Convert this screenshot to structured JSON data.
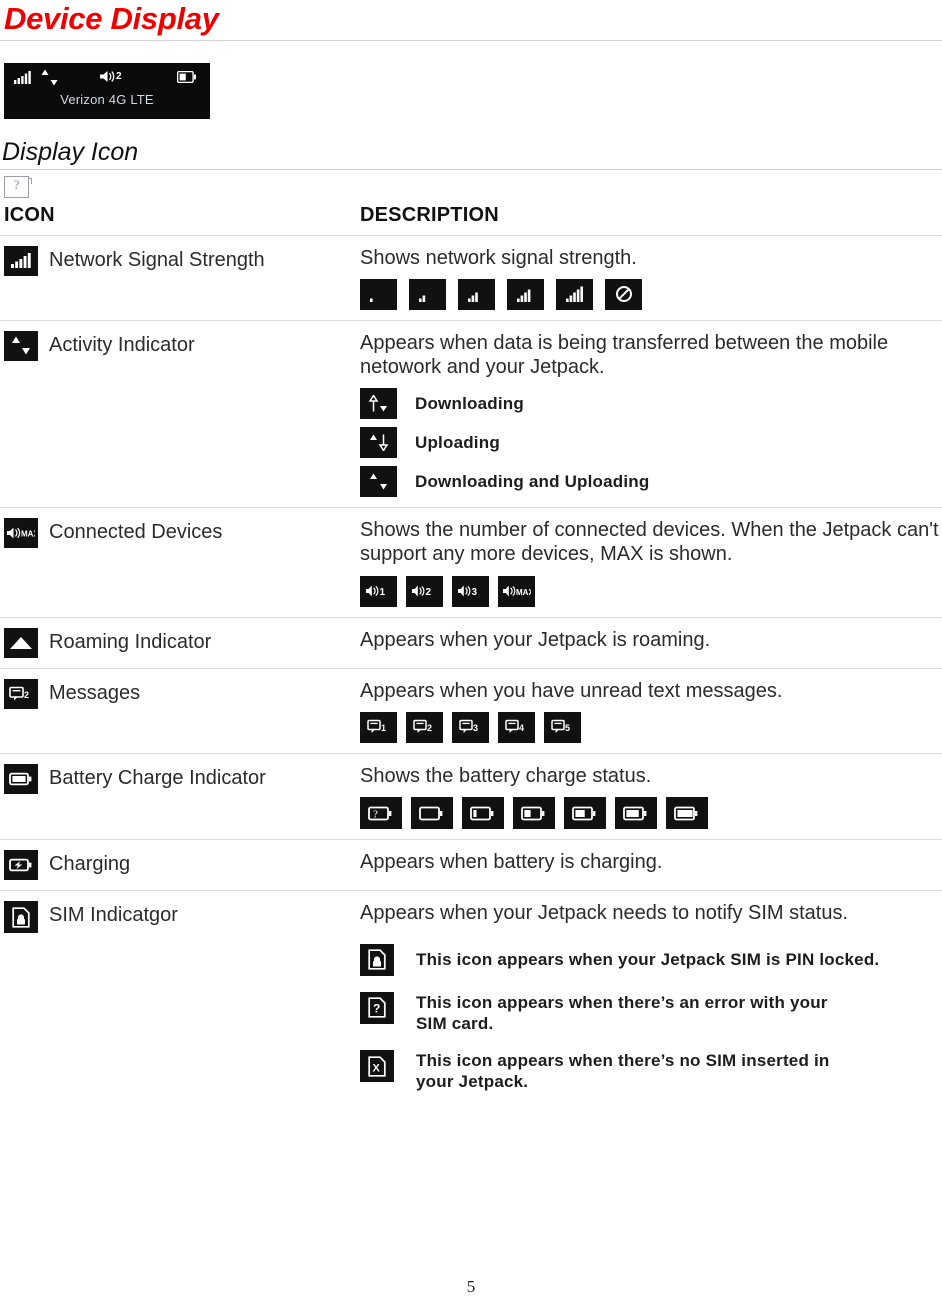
{
  "document": {
    "title": "Device Display",
    "subheading": "Display Icon",
    "page_number": "5",
    "broken_image_placeholder": "broken-image-icon"
  },
  "device_display": {
    "carrier_text": "Verizon 4G LTE",
    "connected_devices_count": "2",
    "icons": [
      "signal-bars-icon",
      "activity-updown-icon",
      "connected-devices-icon",
      "battery-icon"
    ]
  },
  "table": {
    "headers": {
      "icon": "ICON",
      "description": "DESCRIPTION"
    },
    "rows": [
      {
        "name": "Network Signal Strength",
        "icon": "signal-bars-icon",
        "description": "Shows network signal strength.",
        "variants": [
          {
            "icon": "signal-0-icon",
            "label": ""
          },
          {
            "icon": "signal-1-icon",
            "label": ""
          },
          {
            "icon": "signal-2-icon",
            "label": ""
          },
          {
            "icon": "signal-3-icon",
            "label": ""
          },
          {
            "icon": "signal-4-icon",
            "label": ""
          },
          {
            "icon": "no-service-icon",
            "label": ""
          }
        ]
      },
      {
        "name": "Activity Indicator",
        "icon": "activity-updown-icon",
        "description": "Appears when data is being transferred between the mobile netowork and your Jetpack.",
        "sub_items": [
          {
            "icon": "downloading-icon",
            "label": "Downloading"
          },
          {
            "icon": "uploading-icon",
            "label": "Uploading"
          },
          {
            "icon": "downloading-uploading-icon",
            "label": "Downloading and Uploading"
          }
        ]
      },
      {
        "name": "Connected Devices",
        "icon": "connected-devices-max-icon",
        "description": "Shows the number of connected devices. When the Jetpack can't support any more devices, MAX is shown.",
        "variants": [
          {
            "icon": "connected-devices-icon",
            "label": "1"
          },
          {
            "icon": "connected-devices-icon",
            "label": "2"
          },
          {
            "icon": "connected-devices-icon",
            "label": "3"
          },
          {
            "icon": "connected-devices-icon",
            "label": "MAX"
          }
        ]
      },
      {
        "name": "Roaming Indicator",
        "icon": "roaming-triangle-icon",
        "description": "Appears when your Jetpack is roaming.",
        "variants": []
      },
      {
        "name": "Messages",
        "icon": "message-icon",
        "description": "Appears when you have unread text messages.",
        "variants": [
          {
            "icon": "message-icon",
            "label": "1"
          },
          {
            "icon": "message-icon",
            "label": "2"
          },
          {
            "icon": "message-icon",
            "label": "3"
          },
          {
            "icon": "message-icon",
            "label": "4"
          },
          {
            "icon": "message-icon",
            "label": "5"
          }
        ]
      },
      {
        "name": "Battery Charge Indicator",
        "icon": "battery-icon",
        "description": "Shows the battery charge status.",
        "variants": [
          {
            "icon": "battery-unknown-icon",
            "label": ""
          },
          {
            "icon": "battery-empty-icon",
            "label": ""
          },
          {
            "icon": "battery-20-icon",
            "label": ""
          },
          {
            "icon": "battery-40-icon",
            "label": ""
          },
          {
            "icon": "battery-60-icon",
            "label": ""
          },
          {
            "icon": "battery-80-icon",
            "label": ""
          },
          {
            "icon": "battery-full-icon",
            "label": ""
          }
        ]
      },
      {
        "name": "Charging",
        "icon": "battery-charging-icon",
        "description": "Appears when battery is charging.",
        "variants": []
      },
      {
        "name": "SIM Indicatgor",
        "icon": "sim-lock-icon",
        "description": "Appears when your Jetpack needs to notify SIM status.",
        "sub_items": [
          {
            "icon": "sim-lock-icon",
            "label": "This icon appears when your Jetpack SIM is PIN locked."
          },
          {
            "icon": "sim-error-icon",
            "label": "This icon appears when there’s an error with your SIM card."
          },
          {
            "icon": "sim-missing-icon",
            "label": "This icon appears when there’s no SIM inserted in your Jetpack."
          }
        ]
      }
    ]
  },
  "colors": {
    "title": "#ee0000",
    "tile_background": "#111111",
    "rule": "#dadada",
    "lcd_background": "#0b0b0b",
    "lcd_carrier_text": "#cfd8e6"
  }
}
